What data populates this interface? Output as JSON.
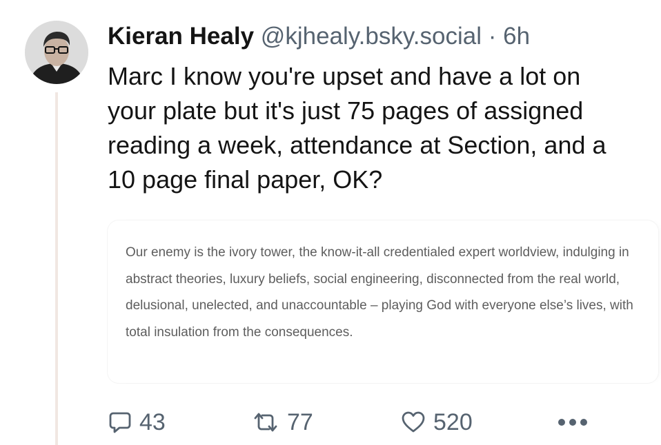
{
  "post": {
    "author_name": "Kieran Healy",
    "handle": "@kjhealy.bsky.social",
    "separator": "·",
    "time_ago": "6h",
    "text": "Marc I know you're upset and have a lot on your plate but it's just 75 pages of assigned reading a week, attendance at Section, and a 10 page final paper, OK?",
    "quote_text": "Our enemy is the ivory tower, the know-it-all credentialed expert worldview, indulging in abstract theories, luxury beliefs, social engineering, disconnected from the real world, delusional, unelected, and unaccountable – playing God with everyone else’s lives, with total insulation from the consequences."
  },
  "actions": {
    "reply_count": "43",
    "repost_count": "77",
    "like_count": "520"
  },
  "icons": {
    "reply": "speech-bubble-icon",
    "repost": "repost-arrows-icon",
    "like": "heart-icon",
    "more": "ellipsis-icon"
  },
  "colors": {
    "text": "#141414",
    "muted": "#566370",
    "quote_text": "#5d5d5d",
    "thread_line": "#f1e7e2"
  }
}
